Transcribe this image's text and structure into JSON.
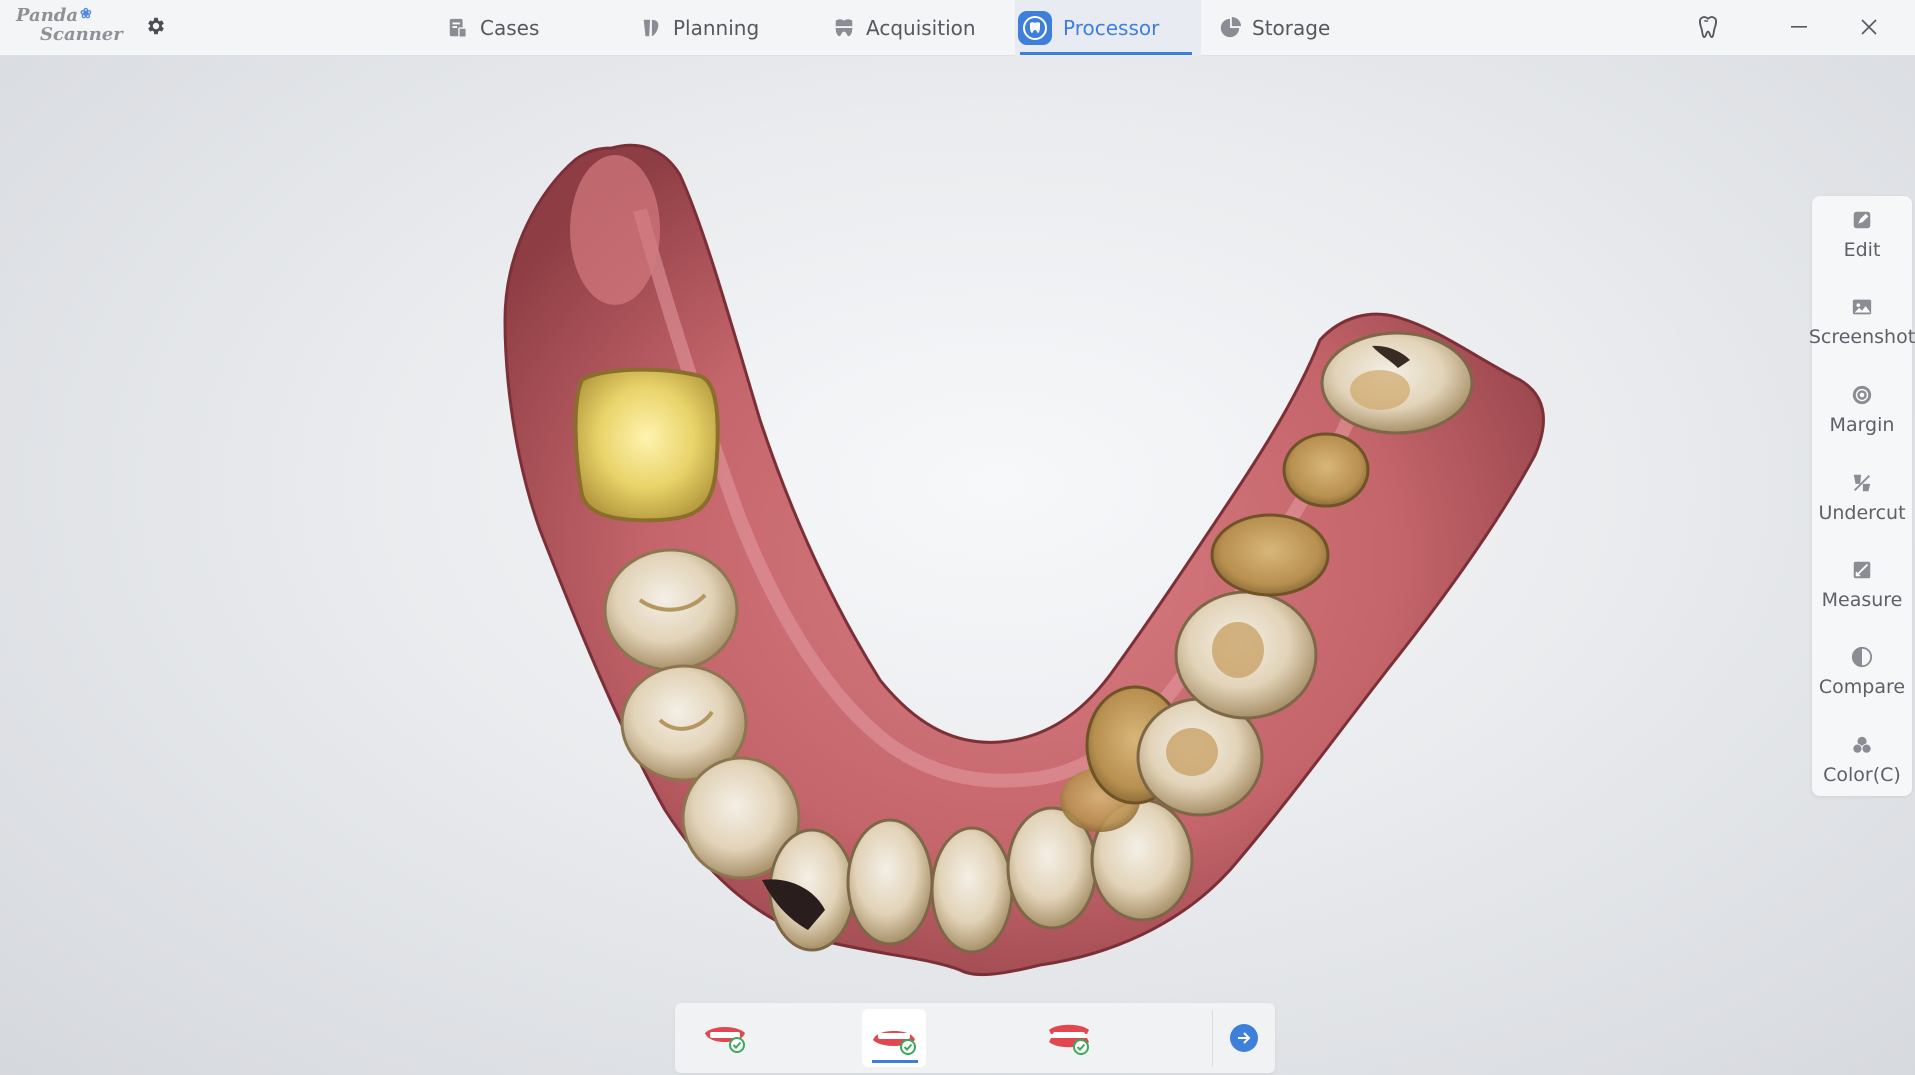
{
  "app": {
    "logo_line1": "Panda",
    "logo_line2": "Scanner"
  },
  "nav": {
    "tabs": [
      {
        "label": "Cases",
        "icon": "cases-icon"
      },
      {
        "label": "Planning",
        "icon": "planning-icon"
      },
      {
        "label": "Acquisition",
        "icon": "acquisition-icon"
      },
      {
        "label": "Processor",
        "icon": "processor-icon",
        "active": true
      },
      {
        "label": "Storage",
        "icon": "storage-icon"
      }
    ]
  },
  "toolbar": {
    "items": [
      {
        "label": "Edit",
        "icon": "edit-icon"
      },
      {
        "label": "Screenshot",
        "icon": "screenshot-icon"
      },
      {
        "label": "Margin",
        "icon": "margin-icon"
      },
      {
        "label": "Undercut",
        "icon": "undercut-icon"
      },
      {
        "label": "Measure",
        "icon": "measure-icon"
      },
      {
        "label": "Compare",
        "icon": "compare-icon"
      },
      {
        "label": "Color(C)",
        "icon": "color-icon"
      }
    ]
  },
  "jaw_selector": {
    "items": [
      {
        "name": "upper-jaw",
        "state": "completed"
      },
      {
        "name": "lower-jaw",
        "state": "completed",
        "active": true
      },
      {
        "name": "bite",
        "state": "completed"
      }
    ]
  },
  "colors": {
    "accent": "#3f7fdc",
    "gum": "#c4656b",
    "tooth": "#e8dcc5",
    "check": "#3aaa5a"
  }
}
